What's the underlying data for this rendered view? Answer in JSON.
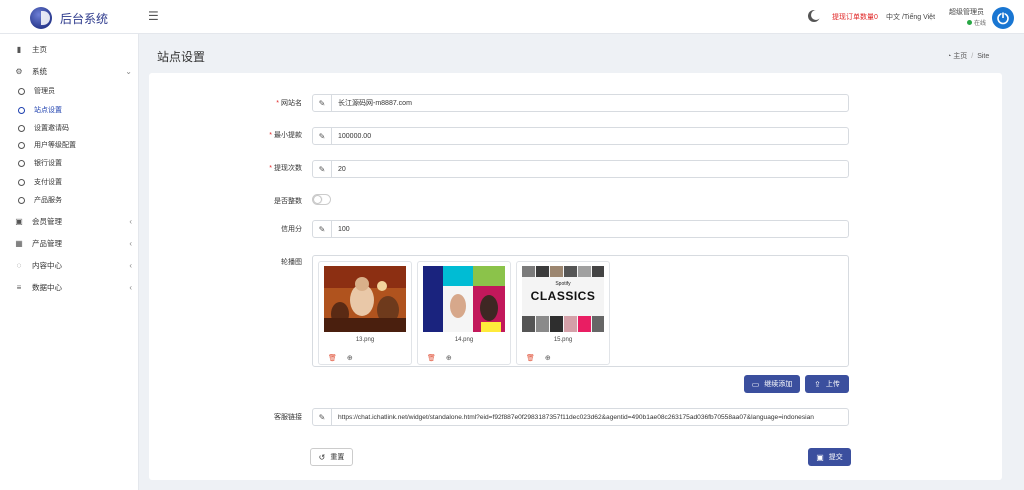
{
  "header": {
    "app_name": "后台系统",
    "menu_icon": "hamburger-icon",
    "withdraw_notice": "提现订单数量0",
    "language": "中文 /Tiếng Việt",
    "admin_name": "超级管理员",
    "admin_status": "在线"
  },
  "sidebar": {
    "home": "主页",
    "system": "系统",
    "system_items": [
      "管理员",
      "站点设置",
      "设置邀请码",
      "用户等级配置",
      "银行设置",
      "支付设置",
      "产品服务"
    ],
    "member": "会员管理",
    "product": "产品管理",
    "content": "内容中心",
    "data": "数据中心"
  },
  "page": {
    "title": "站点设置",
    "breadcrumb_home": "主页",
    "breadcrumb_current": "Site"
  },
  "form": {
    "site_name_label": "网站名",
    "site_name_value": "长江源码网-m8887.com",
    "min_withdraw_label": "最小提款",
    "min_withdraw_value": "100000.00",
    "withdraw_count_label": "提现次数",
    "withdraw_count_value": "20",
    "integer_label": "是否整数",
    "credit_label": "信用分",
    "credit_value": "100",
    "carousel_label": "轮播图",
    "images": [
      "13.png",
      "14.png",
      "15.png"
    ],
    "continue_add": "继续添加",
    "upload": "上传",
    "service_label": "客服链接",
    "service_value": "https://chat.ichatlink.net/widget/standalone.html?eid=f92f887e0f2983187357f11dec023d62&agentid=490b1ae08c263175ad036fb70558aa07&language=indonesian",
    "reset": "重置",
    "submit": "提交"
  },
  "thumb3": {
    "brand": "Spotify",
    "headline": "CLASSICS"
  },
  "colors": {
    "accent": "#3b4f9e",
    "required": "#e02424",
    "online": "#28a745"
  }
}
